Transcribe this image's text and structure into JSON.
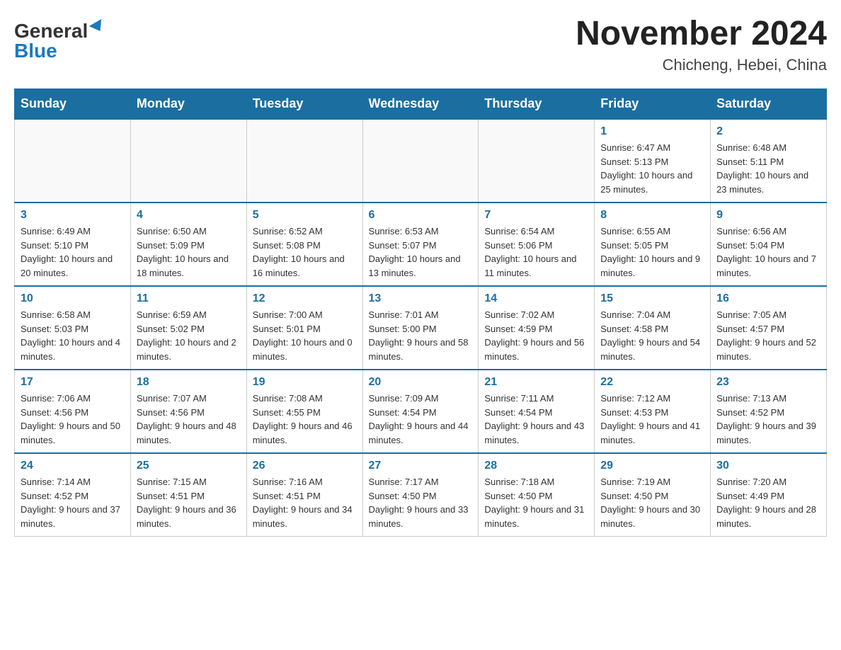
{
  "header": {
    "logo_general": "General",
    "logo_blue": "Blue",
    "month_title": "November 2024",
    "location": "Chicheng, Hebei, China"
  },
  "days_of_week": [
    "Sunday",
    "Monday",
    "Tuesday",
    "Wednesday",
    "Thursday",
    "Friday",
    "Saturday"
  ],
  "weeks": [
    [
      {
        "day": "",
        "info": ""
      },
      {
        "day": "",
        "info": ""
      },
      {
        "day": "",
        "info": ""
      },
      {
        "day": "",
        "info": ""
      },
      {
        "day": "",
        "info": ""
      },
      {
        "day": "1",
        "info": "Sunrise: 6:47 AM\nSunset: 5:13 PM\nDaylight: 10 hours and 25 minutes."
      },
      {
        "day": "2",
        "info": "Sunrise: 6:48 AM\nSunset: 5:11 PM\nDaylight: 10 hours and 23 minutes."
      }
    ],
    [
      {
        "day": "3",
        "info": "Sunrise: 6:49 AM\nSunset: 5:10 PM\nDaylight: 10 hours and 20 minutes."
      },
      {
        "day": "4",
        "info": "Sunrise: 6:50 AM\nSunset: 5:09 PM\nDaylight: 10 hours and 18 minutes."
      },
      {
        "day": "5",
        "info": "Sunrise: 6:52 AM\nSunset: 5:08 PM\nDaylight: 10 hours and 16 minutes."
      },
      {
        "day": "6",
        "info": "Sunrise: 6:53 AM\nSunset: 5:07 PM\nDaylight: 10 hours and 13 minutes."
      },
      {
        "day": "7",
        "info": "Sunrise: 6:54 AM\nSunset: 5:06 PM\nDaylight: 10 hours and 11 minutes."
      },
      {
        "day": "8",
        "info": "Sunrise: 6:55 AM\nSunset: 5:05 PM\nDaylight: 10 hours and 9 minutes."
      },
      {
        "day": "9",
        "info": "Sunrise: 6:56 AM\nSunset: 5:04 PM\nDaylight: 10 hours and 7 minutes."
      }
    ],
    [
      {
        "day": "10",
        "info": "Sunrise: 6:58 AM\nSunset: 5:03 PM\nDaylight: 10 hours and 4 minutes."
      },
      {
        "day": "11",
        "info": "Sunrise: 6:59 AM\nSunset: 5:02 PM\nDaylight: 10 hours and 2 minutes."
      },
      {
        "day": "12",
        "info": "Sunrise: 7:00 AM\nSunset: 5:01 PM\nDaylight: 10 hours and 0 minutes."
      },
      {
        "day": "13",
        "info": "Sunrise: 7:01 AM\nSunset: 5:00 PM\nDaylight: 9 hours and 58 minutes."
      },
      {
        "day": "14",
        "info": "Sunrise: 7:02 AM\nSunset: 4:59 PM\nDaylight: 9 hours and 56 minutes."
      },
      {
        "day": "15",
        "info": "Sunrise: 7:04 AM\nSunset: 4:58 PM\nDaylight: 9 hours and 54 minutes."
      },
      {
        "day": "16",
        "info": "Sunrise: 7:05 AM\nSunset: 4:57 PM\nDaylight: 9 hours and 52 minutes."
      }
    ],
    [
      {
        "day": "17",
        "info": "Sunrise: 7:06 AM\nSunset: 4:56 PM\nDaylight: 9 hours and 50 minutes."
      },
      {
        "day": "18",
        "info": "Sunrise: 7:07 AM\nSunset: 4:56 PM\nDaylight: 9 hours and 48 minutes."
      },
      {
        "day": "19",
        "info": "Sunrise: 7:08 AM\nSunset: 4:55 PM\nDaylight: 9 hours and 46 minutes."
      },
      {
        "day": "20",
        "info": "Sunrise: 7:09 AM\nSunset: 4:54 PM\nDaylight: 9 hours and 44 minutes."
      },
      {
        "day": "21",
        "info": "Sunrise: 7:11 AM\nSunset: 4:54 PM\nDaylight: 9 hours and 43 minutes."
      },
      {
        "day": "22",
        "info": "Sunrise: 7:12 AM\nSunset: 4:53 PM\nDaylight: 9 hours and 41 minutes."
      },
      {
        "day": "23",
        "info": "Sunrise: 7:13 AM\nSunset: 4:52 PM\nDaylight: 9 hours and 39 minutes."
      }
    ],
    [
      {
        "day": "24",
        "info": "Sunrise: 7:14 AM\nSunset: 4:52 PM\nDaylight: 9 hours and 37 minutes."
      },
      {
        "day": "25",
        "info": "Sunrise: 7:15 AM\nSunset: 4:51 PM\nDaylight: 9 hours and 36 minutes."
      },
      {
        "day": "26",
        "info": "Sunrise: 7:16 AM\nSunset: 4:51 PM\nDaylight: 9 hours and 34 minutes."
      },
      {
        "day": "27",
        "info": "Sunrise: 7:17 AM\nSunset: 4:50 PM\nDaylight: 9 hours and 33 minutes."
      },
      {
        "day": "28",
        "info": "Sunrise: 7:18 AM\nSunset: 4:50 PM\nDaylight: 9 hours and 31 minutes."
      },
      {
        "day": "29",
        "info": "Sunrise: 7:19 AM\nSunset: 4:50 PM\nDaylight: 9 hours and 30 minutes."
      },
      {
        "day": "30",
        "info": "Sunrise: 7:20 AM\nSunset: 4:49 PM\nDaylight: 9 hours and 28 minutes."
      }
    ]
  ]
}
